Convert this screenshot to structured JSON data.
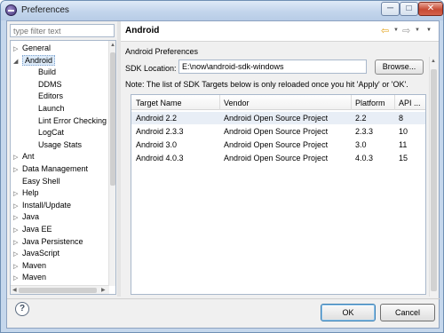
{
  "window": {
    "title": "Preferences",
    "min_glyph": "─",
    "max_glyph": "□",
    "close_glyph": "✕"
  },
  "filter": {
    "placeholder": "type filter text"
  },
  "tree": {
    "items": [
      {
        "label": "General",
        "arrow": "▷",
        "indent": 0
      },
      {
        "label": "Android",
        "arrow": "◢",
        "indent": 0,
        "selected": true
      },
      {
        "label": "Build",
        "arrow": "",
        "indent": 2
      },
      {
        "label": "DDMS",
        "arrow": "",
        "indent": 2
      },
      {
        "label": "Editors",
        "arrow": "",
        "indent": 2
      },
      {
        "label": "Launch",
        "arrow": "",
        "indent": 2
      },
      {
        "label": "Lint Error Checking",
        "arrow": "",
        "indent": 2
      },
      {
        "label": "LogCat",
        "arrow": "",
        "indent": 2
      },
      {
        "label": "Usage Stats",
        "arrow": "",
        "indent": 2
      },
      {
        "label": "Ant",
        "arrow": "▷",
        "indent": 0
      },
      {
        "label": "Data Management",
        "arrow": "▷",
        "indent": 0
      },
      {
        "label": "Easy Shell",
        "arrow": "",
        "indent": 0
      },
      {
        "label": "Help",
        "arrow": "▷",
        "indent": 0
      },
      {
        "label": "Install/Update",
        "arrow": "▷",
        "indent": 0
      },
      {
        "label": "Java",
        "arrow": "▷",
        "indent": 0
      },
      {
        "label": "Java EE",
        "arrow": "▷",
        "indent": 0
      },
      {
        "label": "Java Persistence",
        "arrow": "▷",
        "indent": 0
      },
      {
        "label": "JavaScript",
        "arrow": "▷",
        "indent": 0
      },
      {
        "label": "Maven",
        "arrow": "▷",
        "indent": 0
      },
      {
        "label": "Maven",
        "arrow": "▷",
        "indent": 0
      }
    ]
  },
  "page": {
    "title": "Android",
    "subtitle": "Android Preferences",
    "sdk_label": "SDK Location:",
    "sdk_value": "E:\\now\\android-sdk-windows",
    "browse_label": "Browse...",
    "note": "Note: The list of SDK Targets below is only reloaded once you hit 'Apply' or 'OK'."
  },
  "nav": {
    "back": "⇦",
    "forward": "⇨",
    "caret": "▼"
  },
  "table": {
    "columns": [
      "Target Name",
      "Vendor",
      "Platform",
      "API ..."
    ],
    "rows": [
      [
        "Android 2.2",
        "Android Open Source Project",
        "2.2",
        "8"
      ],
      [
        "Android 2.3.3",
        "Android Open Source Project",
        "2.3.3",
        "10"
      ],
      [
        "Android 3.0",
        "Android Open Source Project",
        "3.0",
        "11"
      ],
      [
        "Android 4.0.3",
        "Android Open Source Project",
        "4.0.3",
        "15"
      ]
    ]
  },
  "footer": {
    "help_glyph": "?",
    "ok_label": "OK",
    "cancel_label": "Cancel"
  },
  "colors": {
    "accent": "#3c7fb1",
    "selection": "#dceaf8",
    "nav_arrow": "#e3a21a"
  }
}
